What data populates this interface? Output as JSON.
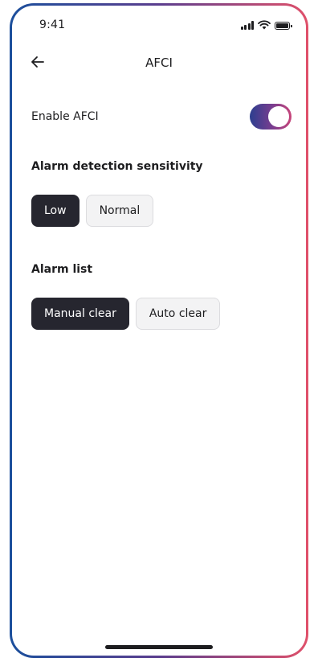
{
  "status_bar": {
    "time": "9:41",
    "signal_icon": "cellular-signal-icon",
    "wifi_icon": "wifi-icon",
    "battery_icon": "battery-icon",
    "battery_level": 1.0
  },
  "nav": {
    "back_icon": "arrow-left-icon",
    "title": "AFCI"
  },
  "enable_afci": {
    "label": "Enable AFCI",
    "enabled": true,
    "toggle_colors": [
      "#2c3f8f",
      "#7a3d8f",
      "#c8457a"
    ]
  },
  "sensitivity": {
    "title": "Alarm detection sensitivity",
    "options": [
      "Low",
      "Normal"
    ],
    "selected": "Low"
  },
  "alarm_list": {
    "title": "Alarm list",
    "options": [
      "Manual clear",
      "Auto clear"
    ],
    "selected": "Manual clear"
  },
  "colors": {
    "selected_chip": "#26262f",
    "unselected_chip": "#f3f3f4",
    "text": "#1d1d1f"
  }
}
